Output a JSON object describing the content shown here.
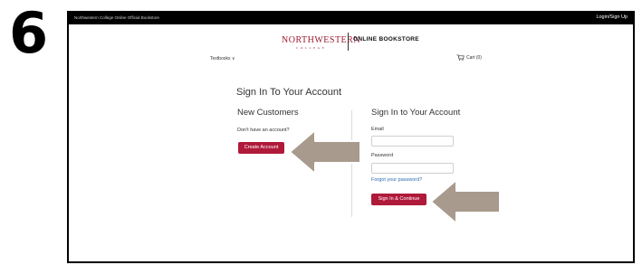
{
  "step": "6",
  "topbar": {
    "site_name": "Northwestern College Online Official Bookstore",
    "login": "Login/Sign Up"
  },
  "logo": {
    "name": "NORTHWESTERN",
    "sub": "COLLEGE",
    "store": "ONLINE BOOKSTORE"
  },
  "nav": {
    "textbooks": "Textbooks ∨",
    "cart": "Cart (0)"
  },
  "main": {
    "title": "Sign In To Your Account",
    "new_customers": {
      "heading": "New Customers",
      "prompt": "Don't have an account?",
      "create_button": "Create Account"
    },
    "signin": {
      "heading": "Sign In to Your Account",
      "email_label": "Email",
      "password_label": "Password",
      "forgot": "Forgot your password?",
      "button": "Sign In & Continue"
    }
  },
  "colors": {
    "brand": "#9b1b30",
    "button": "#b01a3a",
    "link": "#2a6db0",
    "arrow_fill": "#a89a8c"
  },
  "icons": {
    "cart": "cart-icon",
    "arrows": "pointer-arrow-icon"
  }
}
